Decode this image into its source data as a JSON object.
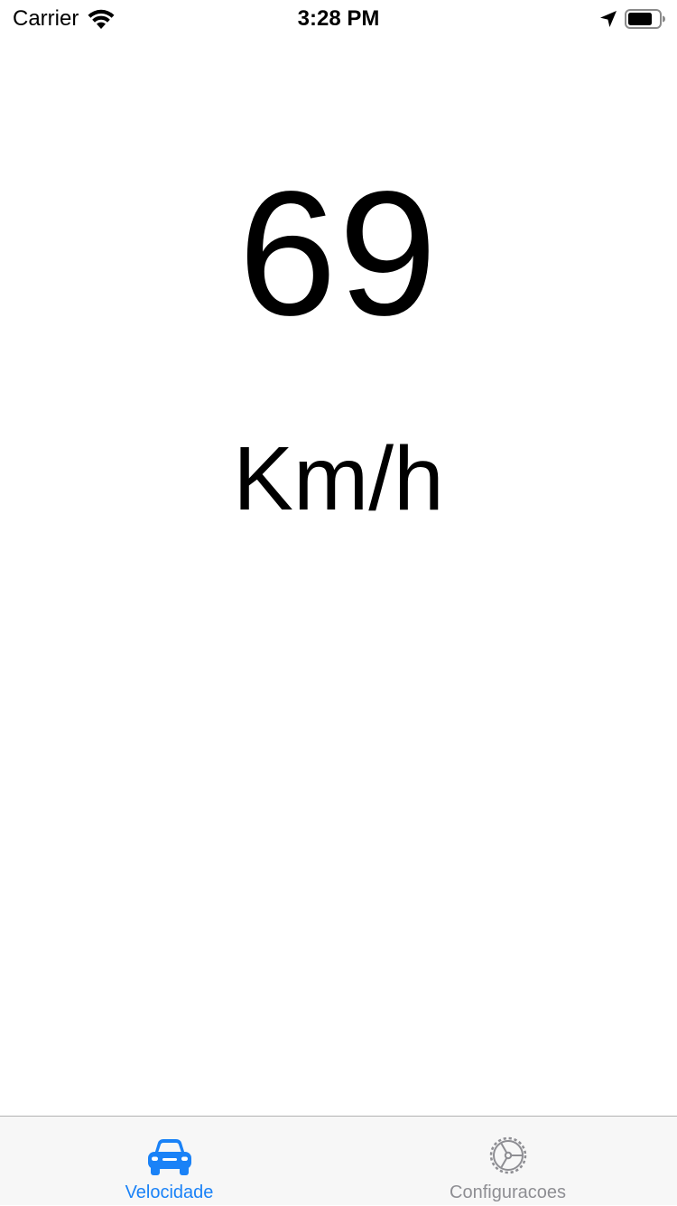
{
  "status_bar": {
    "carrier": "Carrier",
    "time": "3:28 PM",
    "icons": [
      "wifi-icon",
      "location-arrow-icon",
      "battery-icon"
    ]
  },
  "speedometer": {
    "value": "69",
    "unit": "Km/h"
  },
  "tab_bar": {
    "tabs": [
      {
        "label": "Velocidade",
        "icon": "car-icon",
        "selected": true
      },
      {
        "label": "Configuracoes",
        "icon": "gear-icon",
        "selected": false
      }
    ]
  },
  "colors": {
    "accent": "#1a82f7",
    "inactive": "#8e8e93",
    "tab_bar_background": "#f7f7f7",
    "text": "#000000"
  }
}
